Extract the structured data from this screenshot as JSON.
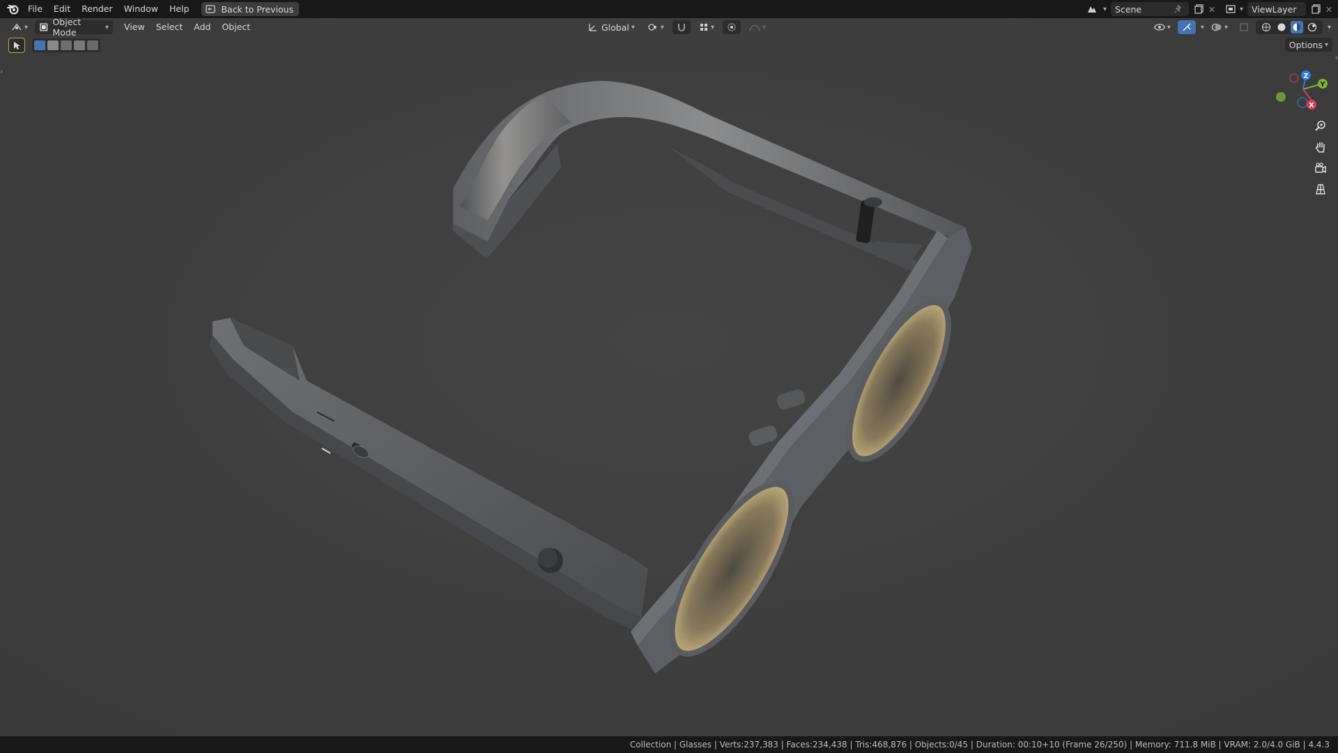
{
  "menu": {
    "items": [
      "File",
      "Edit",
      "Render",
      "Window",
      "Help"
    ],
    "back_button": "Back to Previous"
  },
  "scene": {
    "label": "Scene"
  },
  "view_layer": {
    "label": "ViewLayer"
  },
  "viewport_header": {
    "mode": "Object Mode",
    "menus": [
      "View",
      "Select",
      "Add",
      "Object"
    ],
    "transform_orientation": "Global",
    "options": "Options"
  },
  "gizmo": {
    "x": "X",
    "y": "Y",
    "z": "Z"
  },
  "status_bar": {
    "text": "Collection | Glasses | Verts:237,383 | Faces:234,438 | Tris:468,876 | Objects:0/45 | Duration: 00:10+10 (Frame 26/250) | Memory: 711.8 MiB | VRAM: 2.0/4.0 GiB | 4.4.3"
  },
  "colors": {
    "accent": "#4772b3",
    "axis_x": "#e03a4a",
    "axis_y": "#7bb82c",
    "axis_z": "#2d7ce3"
  }
}
